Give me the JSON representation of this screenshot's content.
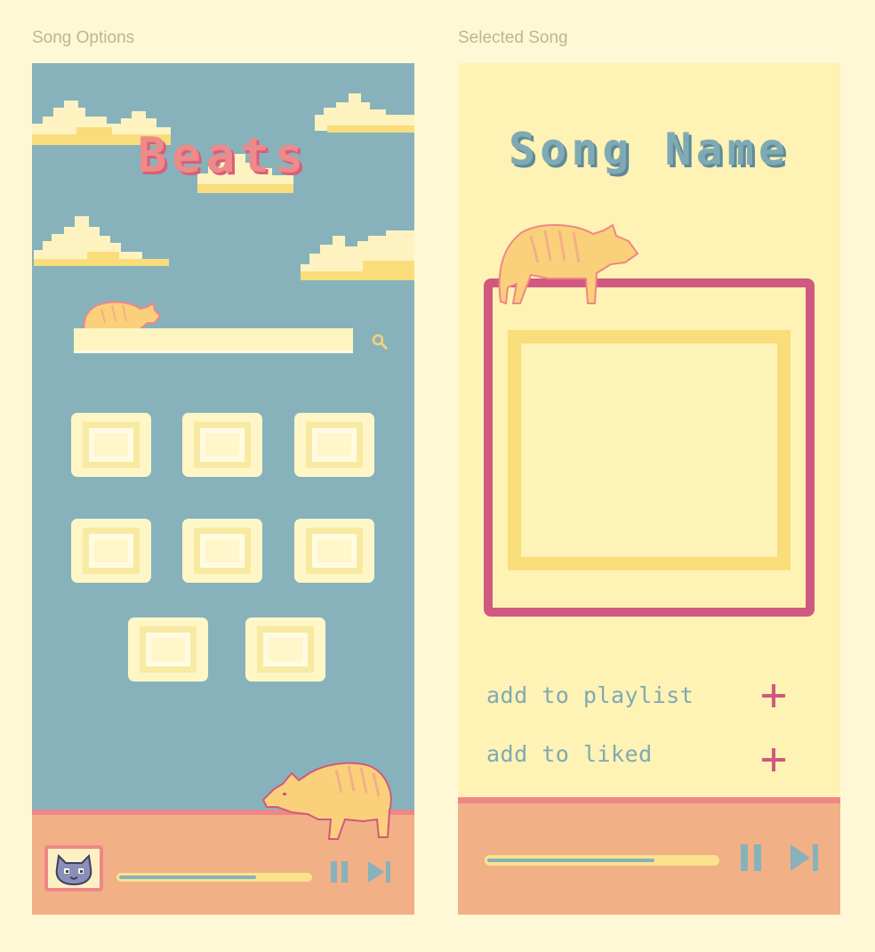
{
  "frames": {
    "left_label": "Song Options",
    "right_label": "Selected Song"
  },
  "song_options": {
    "app_title": "Beats",
    "search": {
      "value": "",
      "placeholder": ""
    },
    "song_tiles": [
      {
        "row": 1,
        "count": 3
      },
      {
        "row": 2,
        "count": 3
      },
      {
        "row": 3,
        "count": 2
      }
    ],
    "player": {
      "progress": 0.72,
      "pause_icon": "pause-icon",
      "next_icon": "skip-next-icon"
    }
  },
  "selected_song": {
    "title": "Song Name",
    "options": [
      {
        "label": "add to playlist",
        "icon": "plus-icon"
      },
      {
        "label": "add to liked",
        "icon": "plus-icon"
      }
    ],
    "player": {
      "progress": 0.73,
      "pause_icon": "pause-icon",
      "next_icon": "skip-next-icon"
    }
  },
  "colors": {
    "sky": "#87b2bb",
    "cream": "#fef2b5",
    "player_bg": "#f2b087",
    "player_border": "#ef8786",
    "title_pink": "#ee8a8a",
    "frame_magenta": "#d0597f",
    "teal_text": "#7fa9b4",
    "cat_orange": "#fbd07a"
  }
}
